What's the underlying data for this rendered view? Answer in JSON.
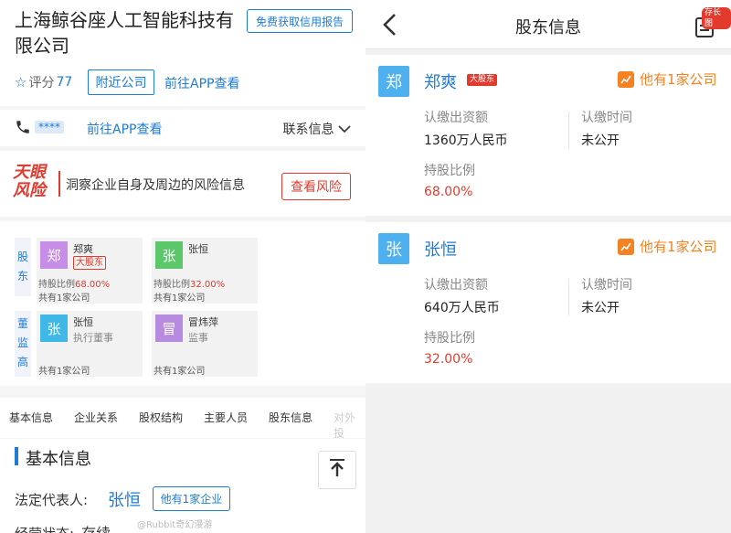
{
  "left": {
    "company": {
      "name": "上海鲸谷座人工智能科技有限公司"
    },
    "credit_report_btn": "免费获取信用报告",
    "rating_label": "评分",
    "rating_value": "77",
    "nearby_btn": "附近公司",
    "open_app": "前往APP查看",
    "phone_masked": "****",
    "open_app_2": "前往APP查看",
    "contact_info": "联系信息",
    "risk": {
      "logo_line1": "天眼",
      "logo_line2": "风险",
      "desc": "洞察企业自身及周边的风险信息",
      "btn": "查看风险"
    },
    "shareholders_label": "股东",
    "managers_label": "董监高",
    "people": [
      {
        "avatar": "郑",
        "name": "郑爽",
        "tag": "大股东",
        "ratio_label": "持股比例",
        "ratio": "68.00%",
        "count": "共有1家公司"
      },
      {
        "avatar": "张",
        "name": "张恒",
        "ratio_label": "持股比例",
        "ratio": "32.00%",
        "count": "共有1家公司"
      },
      {
        "avatar": "张",
        "name": "张恒",
        "role": "执行董事",
        "count": "共有1家公司"
      },
      {
        "avatar": "冒",
        "name": "冒炜萍",
        "role": "监事",
        "count": "共有1家公司"
      }
    ],
    "tabs": [
      "基本信息",
      "企业关系",
      "股权结构",
      "主要人员",
      "股东信息",
      "对外投"
    ],
    "basic": {
      "title": "基本信息",
      "legal_label": "法定代表人:",
      "legal_name": "张恒",
      "legal_btn": "他有1家企业",
      "status_label": "经营状态:",
      "status_value": "存续"
    },
    "watermark": "@Rubbit奇幻漫游"
  },
  "right": {
    "title": "股东信息",
    "save_badge": "存长图",
    "shareholders": [
      {
        "avatar": "郑",
        "name": "郑爽",
        "tag": "大股东",
        "other": "他有1家公司",
        "capital_label": "认缴出资额",
        "capital": "1360万人民币",
        "time_label": "认缴时间",
        "time": "未公开",
        "ratio_label": "持股比例",
        "ratio": "68.00%"
      },
      {
        "avatar": "张",
        "name": "张恒",
        "other": "他有1家公司",
        "capital_label": "认缴出资额",
        "capital": "640万人民币",
        "time_label": "认缴时间",
        "time": "未公开",
        "ratio_label": "持股比例",
        "ratio": "32.00%"
      }
    ]
  },
  "colors": {
    "accent": "#1e7bd6",
    "risk": "#e23b2e",
    "orange": "#f58220",
    "avatar_purple": "#c68ee6",
    "avatar_green": "#5cc66a",
    "avatar_blue": "#4fb0ef",
    "avatar_cyan": "#3fb8e8",
    "avatar_lilac": "#b68be0"
  }
}
